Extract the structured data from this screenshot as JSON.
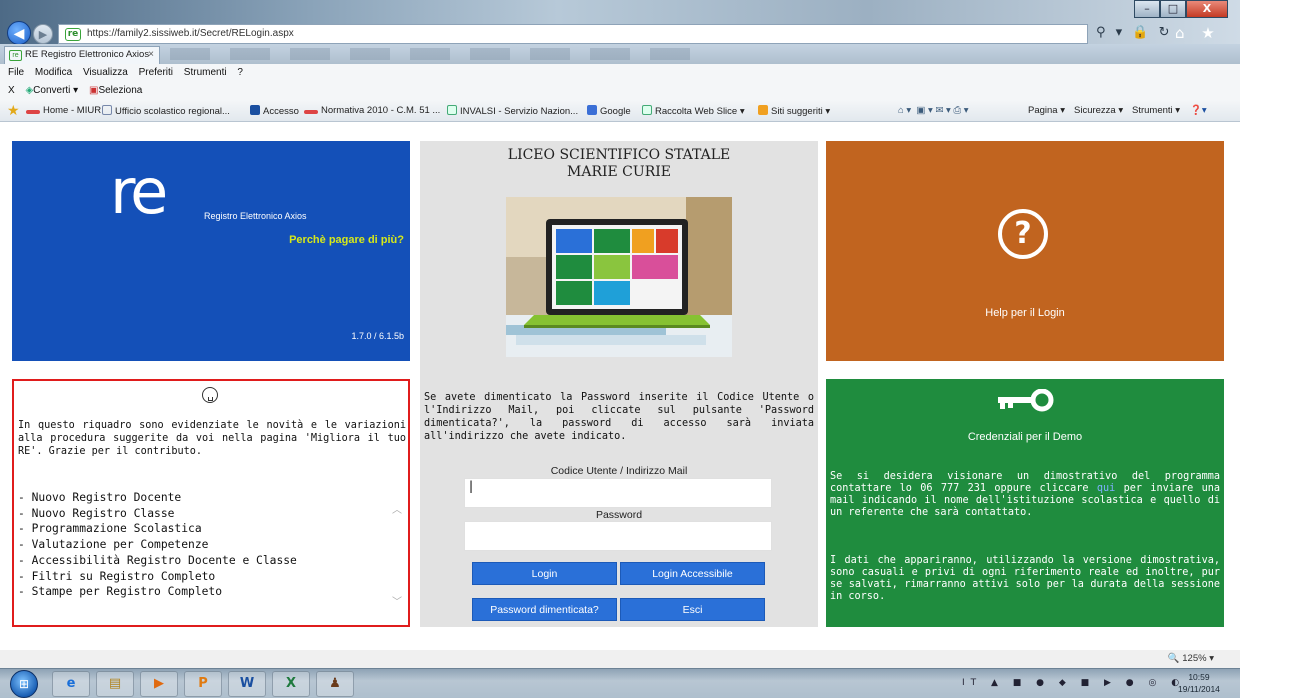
{
  "browser": {
    "url": "https://family2.sissiweb.it/Secret/RELogin.aspx",
    "tab_title": "RE Registro Elettronico Axios",
    "tab_close": "×",
    "win_minimize": "–",
    "win_maximize": "□",
    "win_close": "X",
    "addr_icons": "⚲ ▾ 🔒 ↻",
    "top_icons": "⌂ ★ ⚙",
    "menu": [
      "File",
      "Modifica",
      "Visualizza",
      "Preferiti",
      "Strumenti",
      "?"
    ],
    "command_bar": {
      "close": "X",
      "converti": "Converti",
      "seleziona": "Seleziona"
    },
    "favorites": [
      "Home - MIUR",
      "Ufficio scolastico regional...",
      "Accesso",
      "Normativa 2010 - C.M. 51 ...",
      "INVALSI - Servizio Nazion...",
      "Google",
      "Raccolta Web Slice ▾",
      "Siti suggeriti ▾"
    ],
    "toolbar_right": [
      "Pagina ▾",
      "Sicurezza ▾",
      "Strumenti ▾"
    ],
    "zoom": "125%"
  },
  "brand": {
    "logo": "re",
    "name": "Registro Elettronico Axios",
    "slogan": "Perchè pagare di più?",
    "version": "1.7.0 / 6.1.5b"
  },
  "school": {
    "line1": "LICEO SCIENTIFICO STATALE",
    "line2": "MARIE CURIE"
  },
  "login": {
    "forgot_help": "Se avete dimenticato la Password inserite il Codice Utente o l'Indirizzo Mail, poi cliccate sul pulsante 'Password dimenticata?', la password di accesso sarà inviata all'indirizzo che avete indicato.",
    "user_label": "Codice Utente / Indirizzo Mail",
    "user_value": "|",
    "password_label": "Password",
    "password_value": "",
    "btn_login": "Login",
    "btn_login_accessible": "Login Accessibile",
    "btn_forgot": "Password dimenticata?",
    "btn_exit": "Esci"
  },
  "help": {
    "icon": "?",
    "label": "Help per il Login"
  },
  "news": {
    "intro": "In questo riquadro sono evidenziate le novità e le variazioni alla procedura suggerite da voi nella pagina 'Migliora il tuo RE'. Grazie per il contributo.",
    "items": [
      "- Nuovo Registro Docente",
      "- Nuovo Registro Classe",
      "- Programmazione Scolastica",
      "- Valutazione per Competenze",
      "- Accessibilità Registro Docente e Classe",
      "- Filtri su Registro Completo",
      "- Stampe per Registro Completo"
    ]
  },
  "demo": {
    "title": "Credenziali per il Demo",
    "text1_before": "Se si desidera visionare un dimostrativo del programma contattare lo 06 777 231 oppure cliccare ",
    "text1_link": "qui",
    "text1_after": " per inviare una mail indicando il nome dell'istituzione scolastica e quello di un referente che sarà contattato.",
    "text2": "I dati che appariranno, utilizzando la versione dimostrativa, sono casuali e privi di ogni riferimento reale ed inoltre, pur se salvati, rimarranno attivi solo per la durata della sessione in corso."
  },
  "taskbar": {
    "apps": [
      "e",
      "▤",
      "▶",
      "P",
      "W",
      "X",
      "♟"
    ],
    "language": "IT",
    "time": "10:59",
    "date": "19/11/2014"
  },
  "colors": {
    "brand_blue": "#1450b8",
    "help_orange": "#c1641f",
    "demo_green": "#1f8c3e",
    "news_border": "#e01c1c",
    "button_blue": "#2a70d8"
  }
}
